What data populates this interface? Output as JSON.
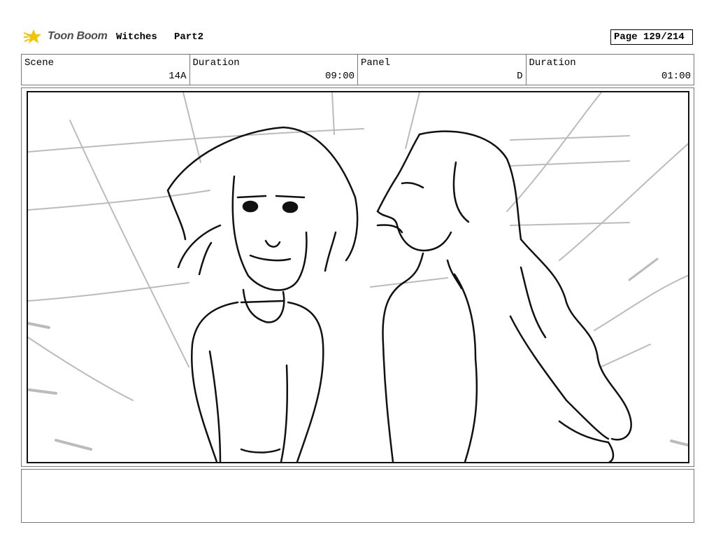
{
  "header": {
    "brand": "Toon Boom",
    "title": "Witches",
    "part": "Part2",
    "page": "Page 129/214"
  },
  "info": [
    {
      "label": "Scene",
      "value": "14A"
    },
    {
      "label": "Duration",
      "value": "09:00"
    },
    {
      "label": "Panel",
      "value": "D"
    },
    {
      "label": "Duration",
      "value": "01:00"
    }
  ],
  "panel": {
    "icon": "storyboard-sketch-two-witches"
  },
  "notes": {
    "text": ""
  },
  "colors": {
    "logo_accent": "#f5c400",
    "sketch_line": "#111111",
    "speed_line": "#bbbbbb"
  }
}
